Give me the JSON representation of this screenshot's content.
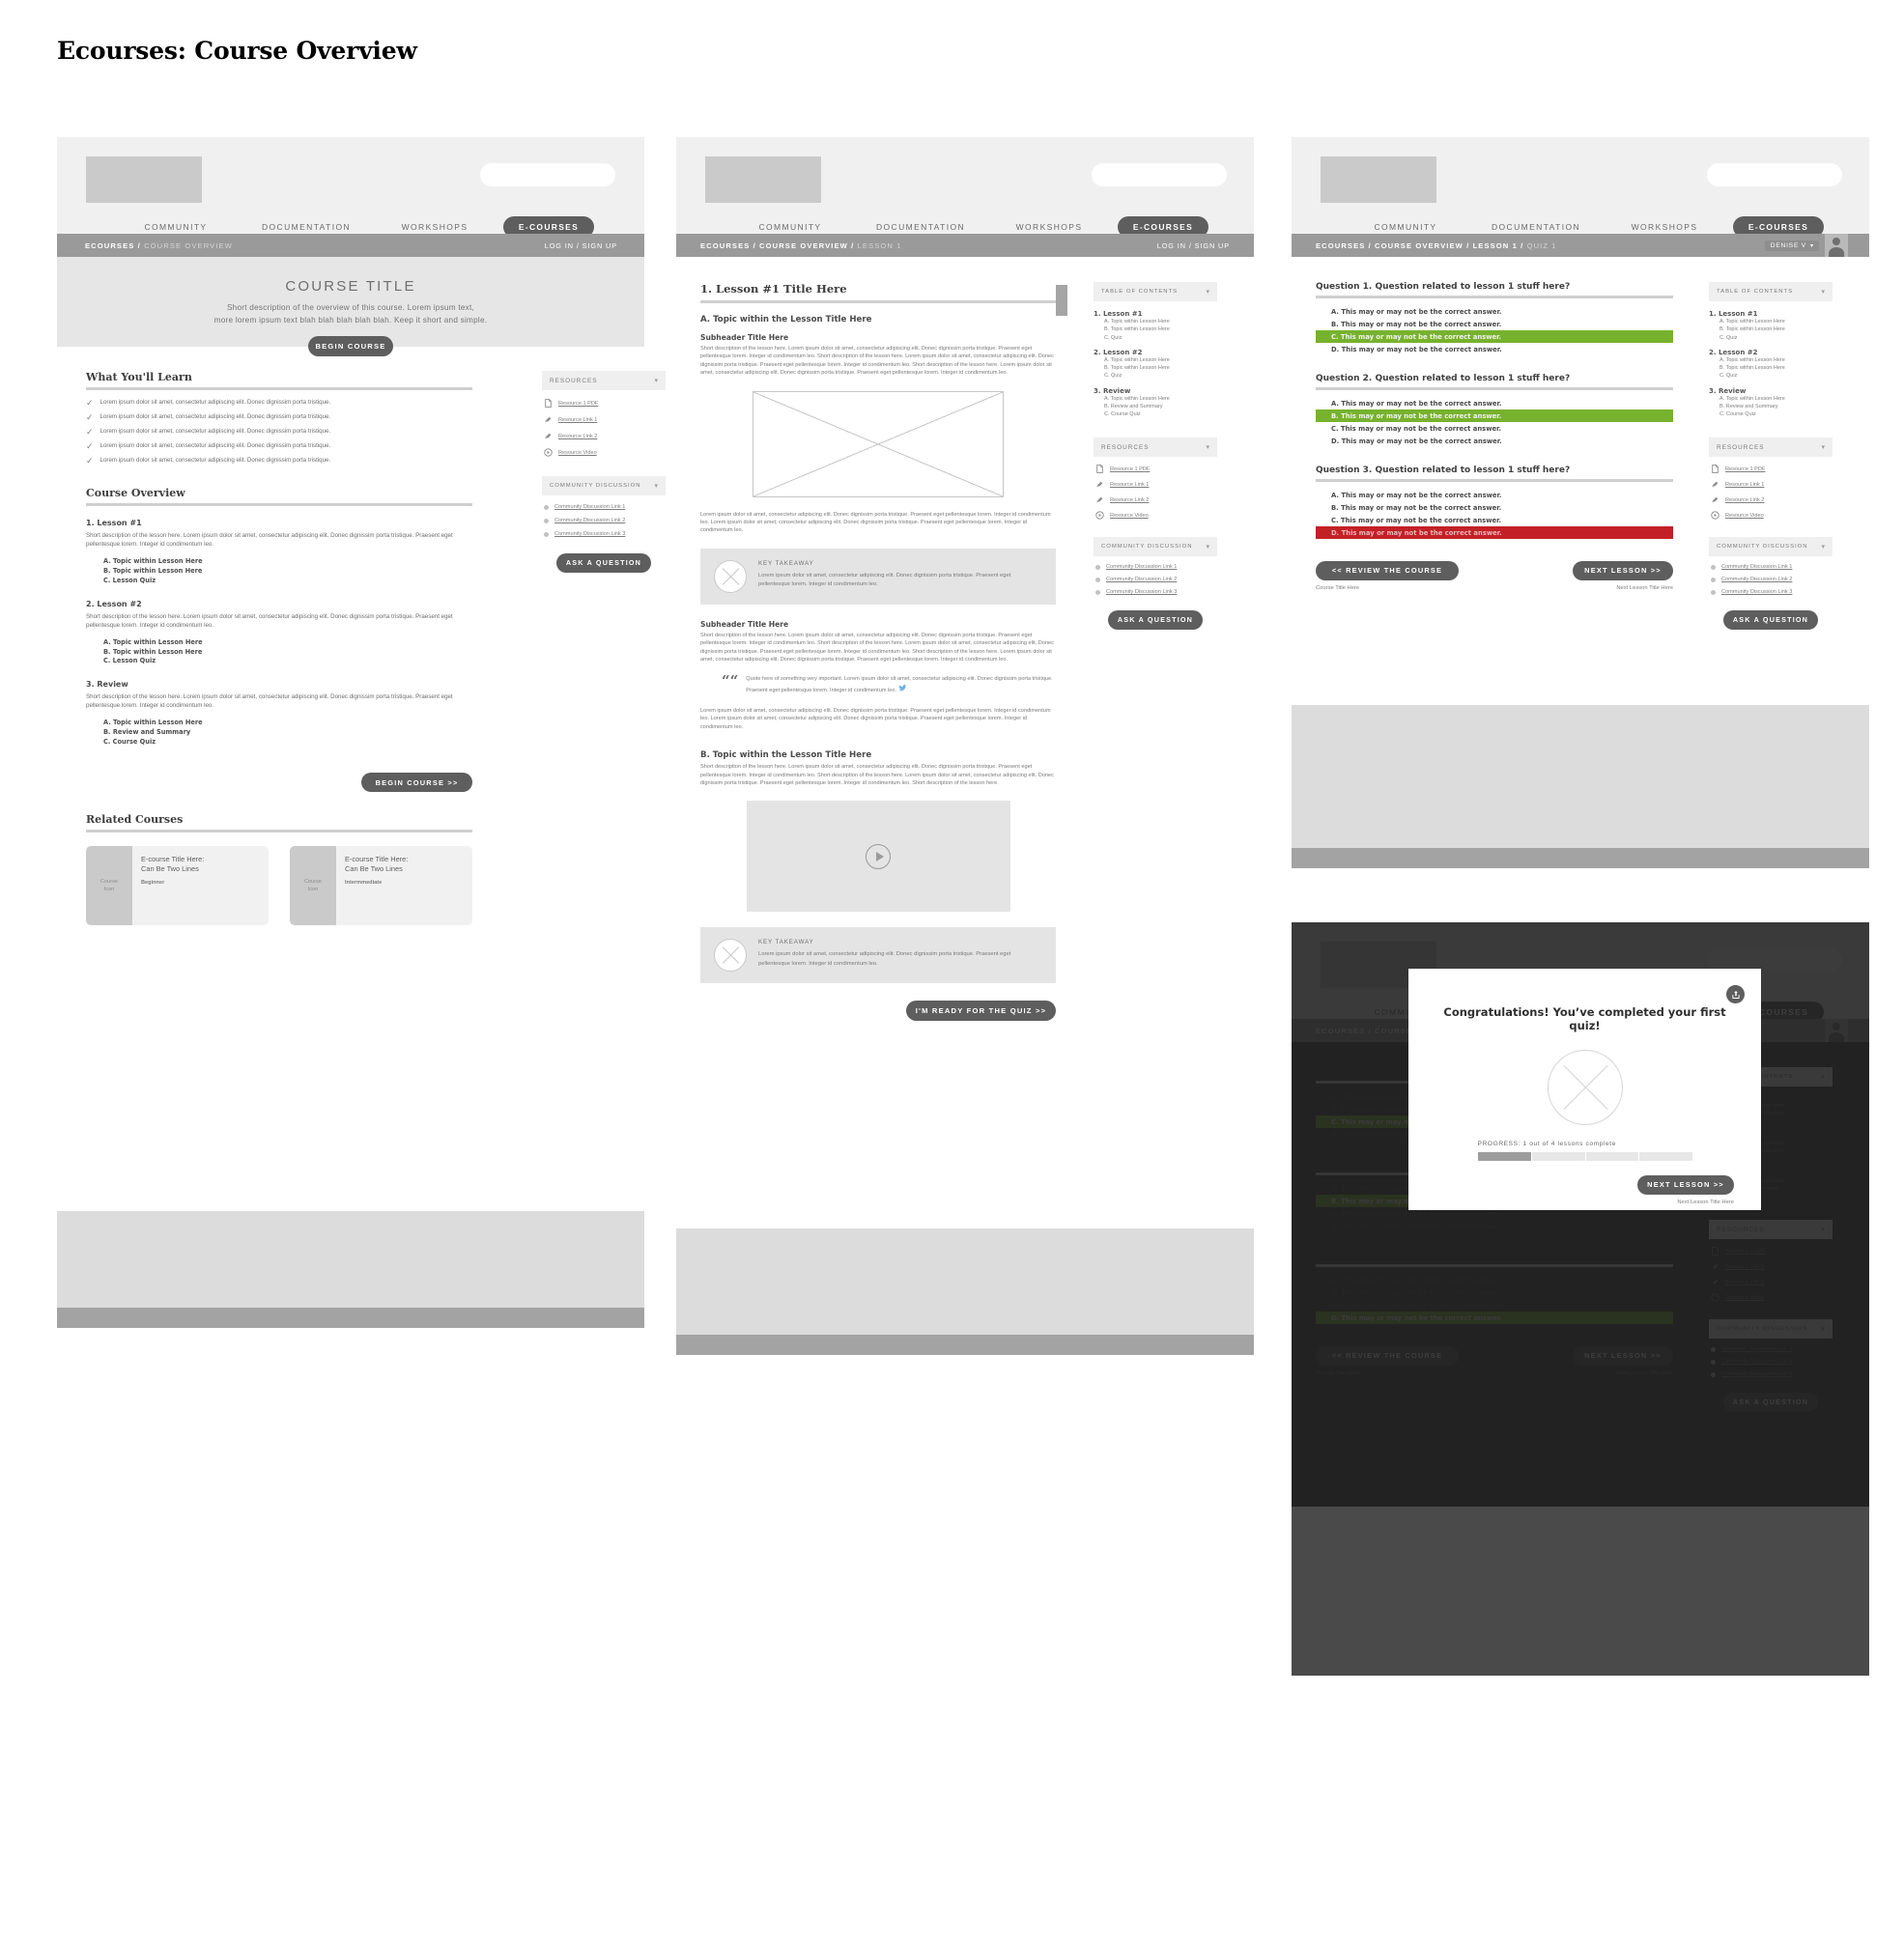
{
  "page_title": "Ecourses: Course Overview",
  "nav": {
    "items": [
      "COMMUNITY",
      "DOCUMENTATION",
      "WORKSHOPS"
    ],
    "active_pill": "E-COURSES"
  },
  "auth_label": "LOG IN / SIGN UP",
  "user_menu": {
    "name": "DENISE V",
    "caret": "▾"
  },
  "breadcrumbs": {
    "overview": {
      "root": "ECOURSES / ",
      "current": "COURSE OVERVIEW"
    },
    "lesson": {
      "root": "ECOURSES / COURSE OVERVIEW / ",
      "current": "LESSON 1"
    },
    "quiz": {
      "root": "ECOURSES / COURSE OVERVIEW / LESSON 1 / ",
      "current": "QUIZ 1"
    }
  },
  "hero": {
    "title": "COURSE TITLE",
    "desc_line1": "Short description of the overview of this course. Lorem ipsum text,",
    "desc_line2": "more lorem ipsum text blah blah blah blah blah. Keep it short and simple.",
    "cta": "BEGIN COURSE"
  },
  "what_youll_learn": {
    "heading": "What You'll Learn",
    "items": [
      "Lorem ipsum dolor sit amet, consectetur adipiscing elit. Donec dignissim porta tristique.",
      "Lorem ipsum dolor sit amet, consectetur adipiscing elit. Donec dignissim porta tristique.",
      "Lorem ipsum dolor sit amet, consectetur adipiscing elit. Donec dignissim porta tristique.",
      "Lorem ipsum dolor sit amet, consectetur adipiscing elit. Donec dignissim porta tristique.",
      "Lorem ipsum dolor sit amet, consectetur adipiscing elit. Donec dignissim porta tristique."
    ],
    "check_glyph": "✓"
  },
  "course_overview": {
    "heading": "Course Overview",
    "lesson_desc": "Short description of the lesson here. Lorem ipsum dolor sit amet, consectetur adipiscing elit. Donec dignissim porta tristique. Praesent eget pellentesque lorem. Integer id condimentum leo.",
    "lessons": [
      {
        "title": "1. Lesson #1",
        "topics": [
          "A. Topic within Lesson Here",
          "B. Topic within Lesson Here",
          "C. Lesson Quiz"
        ]
      },
      {
        "title": "2. Lesson #2",
        "topics": [
          "A. Topic within Lesson Here",
          "B. Topic within Lesson Here",
          "C. Lesson Quiz"
        ]
      },
      {
        "title": "3. Review",
        "topics": [
          "A. Topic within Lesson Here",
          "B. Review and Summary",
          "C. Course Quiz"
        ]
      }
    ],
    "cta": "BEGIN COURSE >>"
  },
  "related_courses": {
    "heading": "Related Courses",
    "cards": [
      {
        "icon_label": "Course\nIcon",
        "title": "E-course Title Here:\nCan Be Two Lines",
        "level": "Beginner"
      },
      {
        "icon_label": "Course\nIcon",
        "title": "E-course Title Here:\nCan Be Two Lines",
        "level": "Intermmediate"
      }
    ]
  },
  "sidebar": {
    "resources_title": "RESOURCES",
    "resources": [
      {
        "label": "Resource 1 PDF",
        "icon": "document-icon"
      },
      {
        "label": "Resource Link 1",
        "icon": "link-icon"
      },
      {
        "label": "Resource Link 2",
        "icon": "link-icon"
      },
      {
        "label": "Resource Video",
        "icon": "video-play-icon"
      }
    ],
    "discussion_title": "COMMUNITY DISCUSSION",
    "discussion": [
      "Community Discussion Link 1",
      "Community Discussion Link 2",
      "Community Discussion Link 3"
    ],
    "ask_cta": "ASK A QUESTION",
    "toc_title": "TABLE OF CONTENTS",
    "toc": [
      {
        "title": "1. Lesson #1",
        "items": [
          "A. Topic within Lesson Here",
          "B. Topic within Lesson Here",
          "C. Quiz"
        ]
      },
      {
        "title": "2. Lesson #2",
        "items": [
          "A. Topic within Lesson Here",
          "B. Topic within Lesson Here",
          "C. Quiz"
        ]
      },
      {
        "title": "3. Review",
        "items": [
          "A. Topic within Lesson Here",
          "B. Review and Summary",
          "C. Course Quiz"
        ]
      }
    ],
    "caret": "▾"
  },
  "lesson": {
    "title": "1. Lesson #1 Title Here",
    "topic_a": "A. Topic within the Lesson Title Here",
    "subheader": "Subheader Title Here",
    "para_long": "Short description of the lesson here. Lorem ipsum dolor sit amet, consectetur adipiscing elit. Donec dignissim porta tristique. Praesent eget pellentesque lorem. Integer id condimentum leo. Short description of the lesson here. Lorem ipsum dolor sit amet, consectetur adipiscing elit. Donec dignissim porta tristique. Praesent eget pellentesque lorem. Integer id condimentum leo. Short description of the lesson here. Lorem ipsum dolor sit amet, consectetur adipiscing elit. Donec dignissim porta tristique. Praesent eget pellentesque lorem. Integer id condimentum leo.",
    "para_mid": "Lorem ipsum dolor sit amet, consectetur adipiscing elit. Donec dignissim porta tristique. Praesent eget pellentesque lorem. Integer id condimentum leo. Lorem ipsum dolor sit amet, consectetur adipiscing elit. Donec dignissim porta tristique. Praesent eget pellentesque lorem. Integer id condimentum leo.",
    "takeaway_title": "KEY TAKEAWAY",
    "takeaway_body": "Lorem ipsum dolor sit amet, consectetur adipiscing elit. Donec dignissim porta tristique. Praesent eget pellentesque lorem. Integer id condimentum leo.",
    "quote": "Quote here of something very important. Lorem ipsum dolor sit amet, consectetur adipiscing elit. Donec dignissim porta tristique. Praesent eget pellentesque lorem. Integer id condimentum leo.",
    "topic_b": "B. Topic within the Lesson Title Here",
    "para_b": "Short description of the lesson here. Lorem ipsum dolor sit amet, consectetur adipiscing elit. Donec dignissim porta tristique. Praesent eget pellentesque lorem. Integer id condimentum leo. Short description of the lesson here. Lorem ipsum dolor sit amet, consectetur adipiscing elit. Donec dignissim porta tristique. Praesent eget pellentesque lorem. Integer id condimentum leo. Short description of the lesson here.",
    "quiz_cta": "I'M READY FOR THE QUIZ >>"
  },
  "quiz": {
    "questions": [
      {
        "title": "Question 1. Question related to lesson 1 stuff here?",
        "answers": [
          {
            "text": "A. This may or may not be the correct answer.",
            "state": "none"
          },
          {
            "text": "B. This may or may not be the correct answer.",
            "state": "none"
          },
          {
            "text": "C. This may or may not be the correct answer.",
            "state": "correct"
          },
          {
            "text": "D. This may or may not be the correct answer.",
            "state": "none"
          }
        ]
      },
      {
        "title": "Question 2. Question related to lesson 1 stuff here?",
        "answers": [
          {
            "text": "A. This may or may not be the correct answer.",
            "state": "none"
          },
          {
            "text": "B. This may or may not be the correct answer.",
            "state": "correct"
          },
          {
            "text": "C. This may or may not be the correct answer.",
            "state": "none"
          },
          {
            "text": "D. This may or may not be the correct answer.",
            "state": "none"
          }
        ]
      },
      {
        "title": "Question 3. Question related to lesson 1 stuff here?",
        "answers": [
          {
            "text": "A. This may or may not be the correct answer.",
            "state": "none"
          },
          {
            "text": "B. This may or may not be the correct answer.",
            "state": "none"
          },
          {
            "text": "C. This may or may not be the correct answer.",
            "state": "none"
          },
          {
            "text": "D. This may or may not be the correct answer.",
            "state": "wrong"
          }
        ]
      }
    ],
    "review_cta": "<< REVIEW THE COURSE",
    "next_cta": "NEXT LESSON >>",
    "review_sub": "Course Title Here",
    "next_sub": "Next Lesson Title Here"
  },
  "modal": {
    "title": "Congratulations! You’ve completed your first quiz!",
    "progress_label": "PROGRESS: 1 out of 4 lessons complete",
    "progress_percent": 25,
    "next_cta": "NEXT LESSON >>",
    "next_sub": "Next Lesson Title Here",
    "share_icon": "share-icon"
  },
  "colors": {
    "correct": "#77b22e",
    "wrong": "#c42027",
    "accent": "#5e5e5e",
    "header_bg": "#f0f0f0",
    "crumb_bg": "#9a9a9a"
  }
}
